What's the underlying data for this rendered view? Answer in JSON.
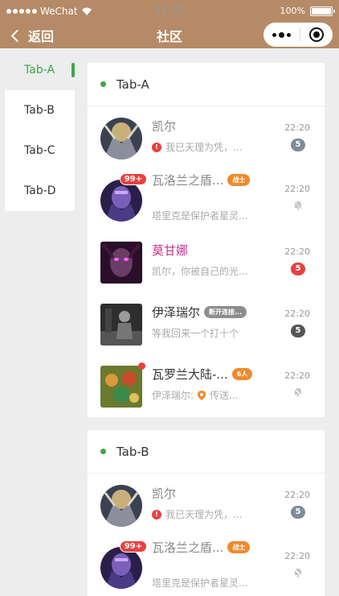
{
  "status": {
    "carrier": "WeChat",
    "time": "21:20",
    "battery": "100%"
  },
  "nav": {
    "back_label": "返回",
    "title": "社区"
  },
  "sidebar": {
    "items": [
      {
        "label": "Tab-A",
        "active": true
      },
      {
        "label": "Tab-B",
        "active": false
      },
      {
        "label": "Tab-C",
        "active": false
      },
      {
        "label": "Tab-D",
        "active": false
      }
    ]
  },
  "sections": [
    {
      "title": "Tab-A",
      "rows": [
        {
          "name": "凯尔",
          "message": "我已天理为凭，...",
          "time": "22:20",
          "count": "5",
          "icon": "warning-icon"
        },
        {
          "name": "瓦洛兰之盾...",
          "tag": "战士",
          "message": "塔里克是保护者星灵...",
          "time": "22:20",
          "badge": "99+",
          "muted": true
        },
        {
          "name": "莫甘娜",
          "message": "凯尔，你被自己的光...",
          "time": "22:20",
          "count": "5"
        },
        {
          "name": "伊泽瑞尔",
          "tag": "断开连接...",
          "message": "等我回来一个打十个",
          "time": "22:20",
          "count": "5"
        },
        {
          "name": "瓦罗兰大陆-...",
          "tag": "6人",
          "message_prefix": "伊泽瑞尔:",
          "message": "传送...",
          "time": "22:20",
          "muted": true,
          "icon": "location-pin-icon"
        }
      ]
    },
    {
      "title": "Tab-B",
      "rows": [
        {
          "name": "凯尔",
          "message": "我已天理为凭，...",
          "time": "22:20",
          "count": "5",
          "icon": "warning-icon"
        },
        {
          "name": "瓦洛兰之盾...",
          "tag": "战士",
          "message": "塔里克是保护者星灵...",
          "time": "22:20",
          "badge": "99+",
          "muted": true
        }
      ]
    }
  ],
  "colors": {
    "header": "#b58a66",
    "accent": "#3aa84a",
    "badge_red": "#e6423f",
    "tag_orange": "#ef8a2c"
  }
}
